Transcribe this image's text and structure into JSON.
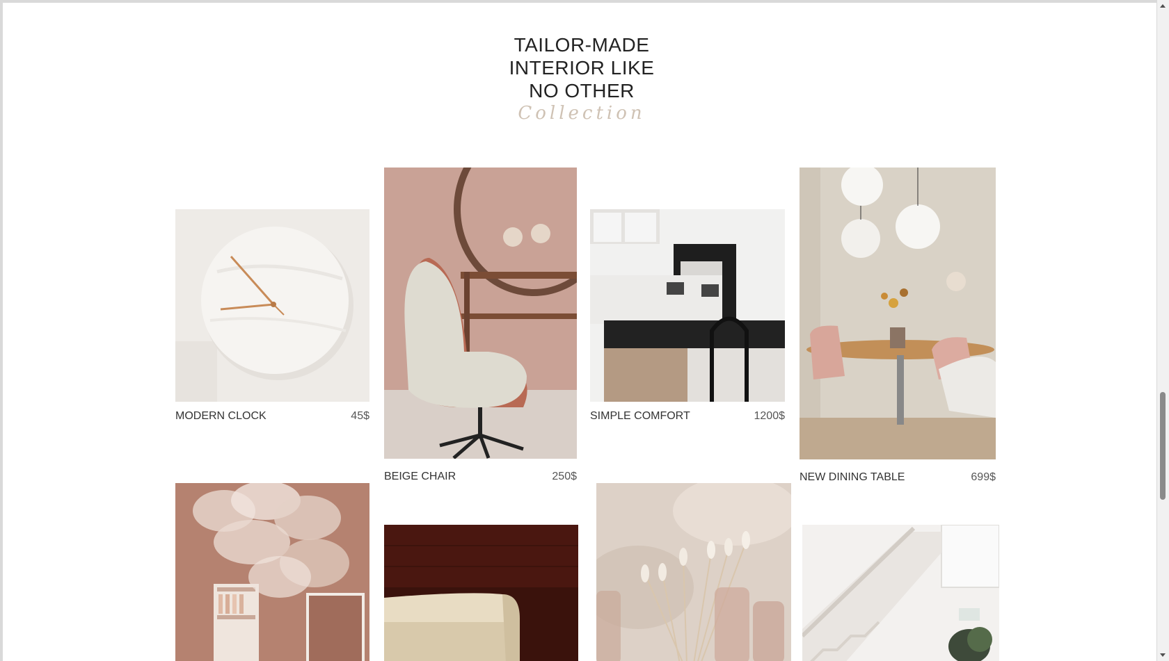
{
  "heading": {
    "lines": [
      "TAILOR-MADE",
      "INTERIOR LIKE",
      "NO OTHER"
    ],
    "subtitle": "Collection"
  },
  "products": [
    {
      "name": "MODERN CLOCK",
      "price": "45$",
      "image": "marble-wall-clock-photo"
    },
    {
      "name": "BEIGE CHAIR",
      "price": "250$",
      "image": "beige-armchair-photo"
    },
    {
      "name": "SIMPLE COMFORT",
      "price": "1200$",
      "image": "living-room-fireplace-photo"
    },
    {
      "name": "NEW DINING TABLE",
      "price": "699$",
      "image": "dining-table-pendant-lamps-photo"
    },
    {
      "image": "glass-chandelier-photo"
    },
    {
      "image": "cream-sofa-photo"
    },
    {
      "image": "dried-flowers-vases-photo"
    },
    {
      "image": "white-staircase-photo"
    }
  ]
}
